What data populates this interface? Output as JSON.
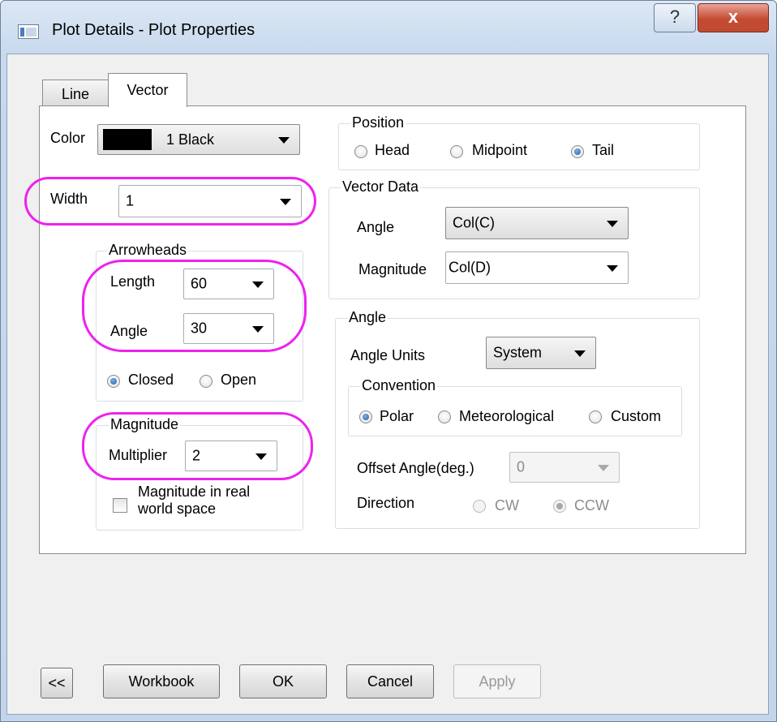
{
  "window": {
    "title": "Plot Details - Plot Properties",
    "help_label": "?",
    "close_label": "x"
  },
  "tabs": [
    {
      "label": "Line"
    },
    {
      "label": "Vector"
    }
  ],
  "left": {
    "color_label": "Color",
    "color_value": "1 Black",
    "color_swatch": "#000000",
    "width_label": "Width",
    "width_value": "1",
    "arrowheads": {
      "title": "Arrowheads",
      "length_label": "Length",
      "length_value": "60",
      "angle_label": "Angle",
      "angle_value": "30",
      "closed_label": "Closed",
      "open_label": "Open",
      "selected": "Closed"
    },
    "magnitude": {
      "title": "Magnitude",
      "multiplier_label": "Multiplier",
      "multiplier_value": "2",
      "realworld_label_line1": "Magnitude in real",
      "realworld_label_line2": "world space",
      "realworld_checked": false
    }
  },
  "right": {
    "position": {
      "title": "Position",
      "head": "Head",
      "midpoint": "Midpoint",
      "tail": "Tail",
      "selected": "Tail"
    },
    "vector_data": {
      "title": "Vector Data",
      "angle_label": "Angle",
      "angle_value": "Col(C)",
      "magnitude_label": "Magnitude",
      "magnitude_value": "Col(D)"
    },
    "angle": {
      "title": "Angle",
      "units_label": "Angle Units",
      "units_value": "System",
      "convention": {
        "title": "Convention",
        "polar": "Polar",
        "meteorological": "Meteorological",
        "custom": "Custom",
        "selected": "Polar"
      },
      "offset_label": "Offset Angle(deg.)",
      "offset_value": "0",
      "direction_label": "Direction",
      "cw": "CW",
      "ccw": "CCW",
      "direction_selected": "CCW"
    }
  },
  "buttons": {
    "collapse": "<<",
    "workbook": "Workbook",
    "ok": "OK",
    "cancel": "Cancel",
    "apply": "Apply"
  },
  "colors": {
    "highlight": "#ee22ee",
    "radio_selected": "#1d5fa8"
  }
}
